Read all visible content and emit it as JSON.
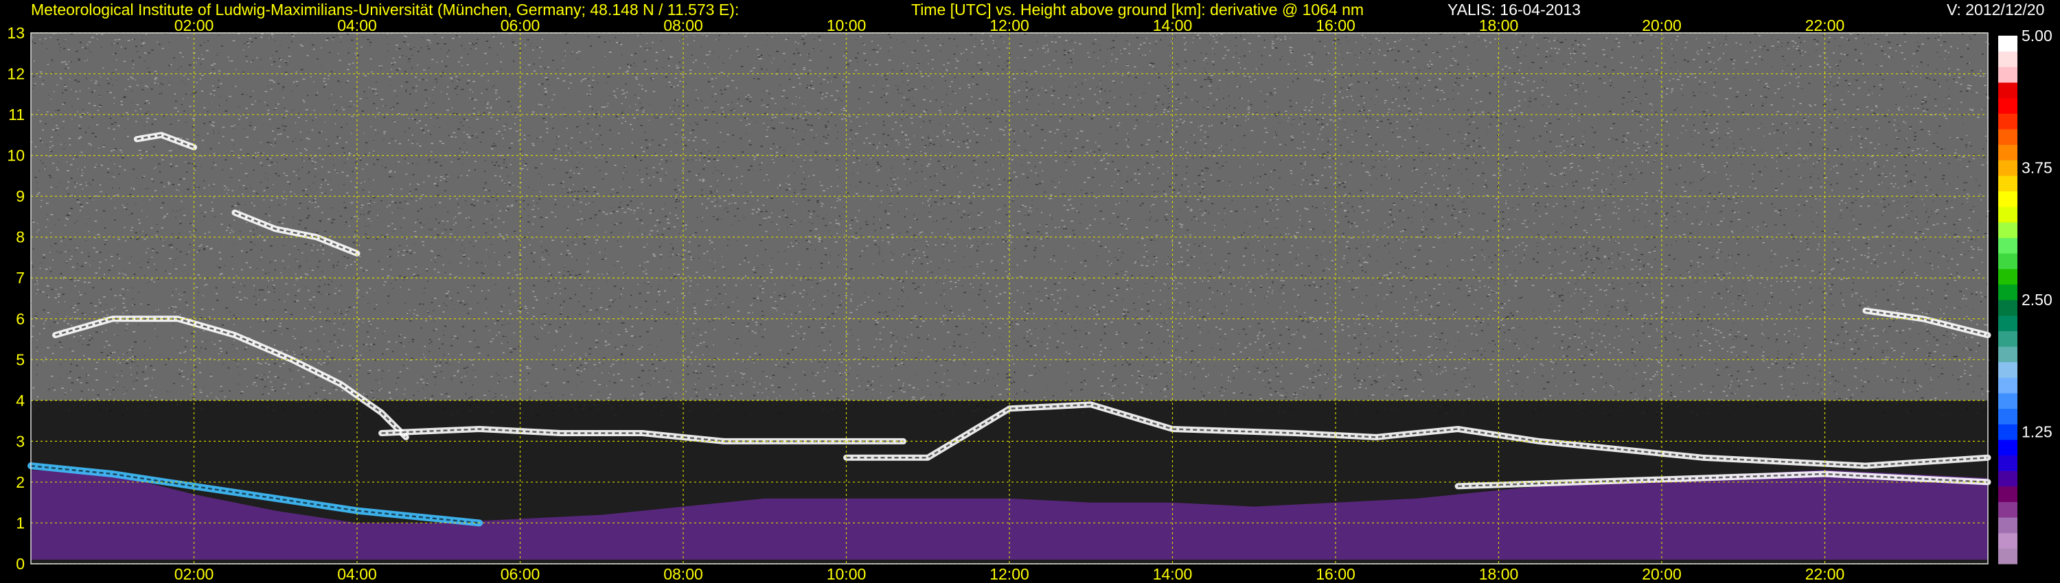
{
  "header": {
    "institute": "Meteorological Institute of Ludwig-Maximilians-Universität (München, Germany; 48.148 N / 11.573 E):",
    "title": "Time [UTC] vs. Height above ground [km]: derivative @ 1064 nm",
    "station_date": "YALIS: 16-04-2013",
    "version": "V: 2012/12/20"
  },
  "colors": {
    "background": "#000000",
    "axis_text": "#ffff00",
    "grid": "#d8d800",
    "header_white": "#ffffff"
  },
  "chart_data": {
    "type": "heatmap",
    "xlabel": "Time [UTC]",
    "ylabel": "Height above ground [km]",
    "x_range_hours": [
      0.0,
      24.0
    ],
    "y_range_km": [
      0,
      13
    ],
    "x_ticks": [
      "02:00",
      "04:00",
      "06:00",
      "08:00",
      "10:00",
      "12:00",
      "14:00",
      "16:00",
      "18:00",
      "20:00",
      "22:00"
    ],
    "y_ticks": [
      "0",
      "1",
      "2",
      "3",
      "4",
      "5",
      "6",
      "7",
      "8",
      "9",
      "10",
      "11",
      "12",
      "13"
    ],
    "grid": true,
    "colorbar": {
      "range": [
        0.0,
        5.0
      ],
      "tick_labels": [
        "1.25",
        "2.50",
        "3.75",
        "5.00"
      ],
      "colors": [
        "#b088b8",
        "#c090c8",
        "#a070b0",
        "#883890",
        "#700068",
        "#4800a0",
        "#2000d8",
        "#0000ff",
        "#0040ff",
        "#2070ff",
        "#4090ff",
        "#70b0ff",
        "#88c0f0",
        "#60b0b0",
        "#30a088",
        "#008860",
        "#007840",
        "#00a020",
        "#20c000",
        "#40d840",
        "#60f060",
        "#a0ff40",
        "#e0ff00",
        "#ffff00",
        "#ffd800",
        "#ffb000",
        "#ff8800",
        "#ff6000",
        "#ff3000",
        "#ff0000",
        "#e80000",
        "#ffc0c8",
        "#ffe0e0",
        "#ffffff"
      ]
    },
    "layers": [
      {
        "name": "aerosol-mixing-layer",
        "start_h": 0.0,
        "end_h": 24.0,
        "base_km": 0.1,
        "top_km": [
          2.3,
          2.2,
          1.7,
          1.3,
          1.0,
          1.0,
          1.1,
          1.2,
          1.4,
          1.6,
          1.6,
          1.6,
          1.6,
          1.5,
          1.5,
          1.4,
          1.5,
          1.6,
          1.8,
          2.0,
          2.1,
          2.2,
          2.3,
          2.2,
          2.1
        ]
      },
      {
        "name": "elevated-aerosol-layer",
        "start_h": 0.0,
        "end_h": 5.5,
        "points": [
          [
            0.0,
            2.4
          ],
          [
            1.0,
            2.2
          ],
          [
            2.0,
            1.9
          ],
          [
            3.0,
            1.6
          ],
          [
            4.0,
            1.3
          ],
          [
            5.0,
            1.1
          ],
          [
            5.5,
            1.0
          ]
        ]
      },
      {
        "name": "cloud-layer-1",
        "start_h": 0.3,
        "end_h": 4.6,
        "points": [
          [
            0.3,
            5.6
          ],
          [
            1.0,
            6.0
          ],
          [
            1.8,
            6.0
          ],
          [
            2.5,
            5.6
          ],
          [
            3.2,
            5.0
          ],
          [
            3.8,
            4.4
          ],
          [
            4.3,
            3.7
          ],
          [
            4.6,
            3.1
          ]
        ]
      },
      {
        "name": "cloud-layer-2",
        "start_h": 4.3,
        "end_h": 10.7,
        "points": [
          [
            4.3,
            3.2
          ],
          [
            5.5,
            3.3
          ],
          [
            6.5,
            3.2
          ],
          [
            7.5,
            3.2
          ],
          [
            8.5,
            3.0
          ],
          [
            9.5,
            3.0
          ],
          [
            10.7,
            3.0
          ]
        ]
      },
      {
        "name": "cloud-layer-3",
        "start_h": 10.0,
        "end_h": 24.0,
        "points": [
          [
            10.0,
            2.6
          ],
          [
            11.0,
            2.6
          ],
          [
            12.0,
            3.8
          ],
          [
            13.0,
            3.9
          ],
          [
            14.0,
            3.3
          ],
          [
            15.5,
            3.2
          ],
          [
            16.5,
            3.1
          ],
          [
            17.5,
            3.3
          ],
          [
            18.5,
            3.0
          ],
          [
            19.5,
            2.8
          ],
          [
            20.5,
            2.6
          ],
          [
            21.5,
            2.5
          ],
          [
            22.5,
            2.4
          ],
          [
            24.0,
            2.6
          ]
        ]
      },
      {
        "name": "cloud-layer-4",
        "start_h": 17.5,
        "end_h": 24.0,
        "points": [
          [
            17.5,
            1.9
          ],
          [
            19.0,
            2.0
          ],
          [
            20.5,
            2.1
          ],
          [
            22.0,
            2.2
          ],
          [
            23.0,
            2.1
          ],
          [
            24.0,
            2.0
          ]
        ]
      },
      {
        "name": "cirrus-1",
        "start_h": 1.3,
        "end_h": 2.0,
        "points": [
          [
            1.3,
            10.4
          ],
          [
            1.6,
            10.5
          ],
          [
            2.0,
            10.2
          ]
        ]
      },
      {
        "name": "cirrus-2",
        "start_h": 2.5,
        "end_h": 4.0,
        "points": [
          [
            2.5,
            8.6
          ],
          [
            3.0,
            8.2
          ],
          [
            3.5,
            8.0
          ],
          [
            4.0,
            7.6
          ]
        ]
      },
      {
        "name": "cirrus-3",
        "start_h": 22.5,
        "end_h": 24.0,
        "points": [
          [
            22.5,
            6.2
          ],
          [
            23.2,
            6.0
          ],
          [
            24.0,
            5.6
          ]
        ]
      }
    ]
  }
}
